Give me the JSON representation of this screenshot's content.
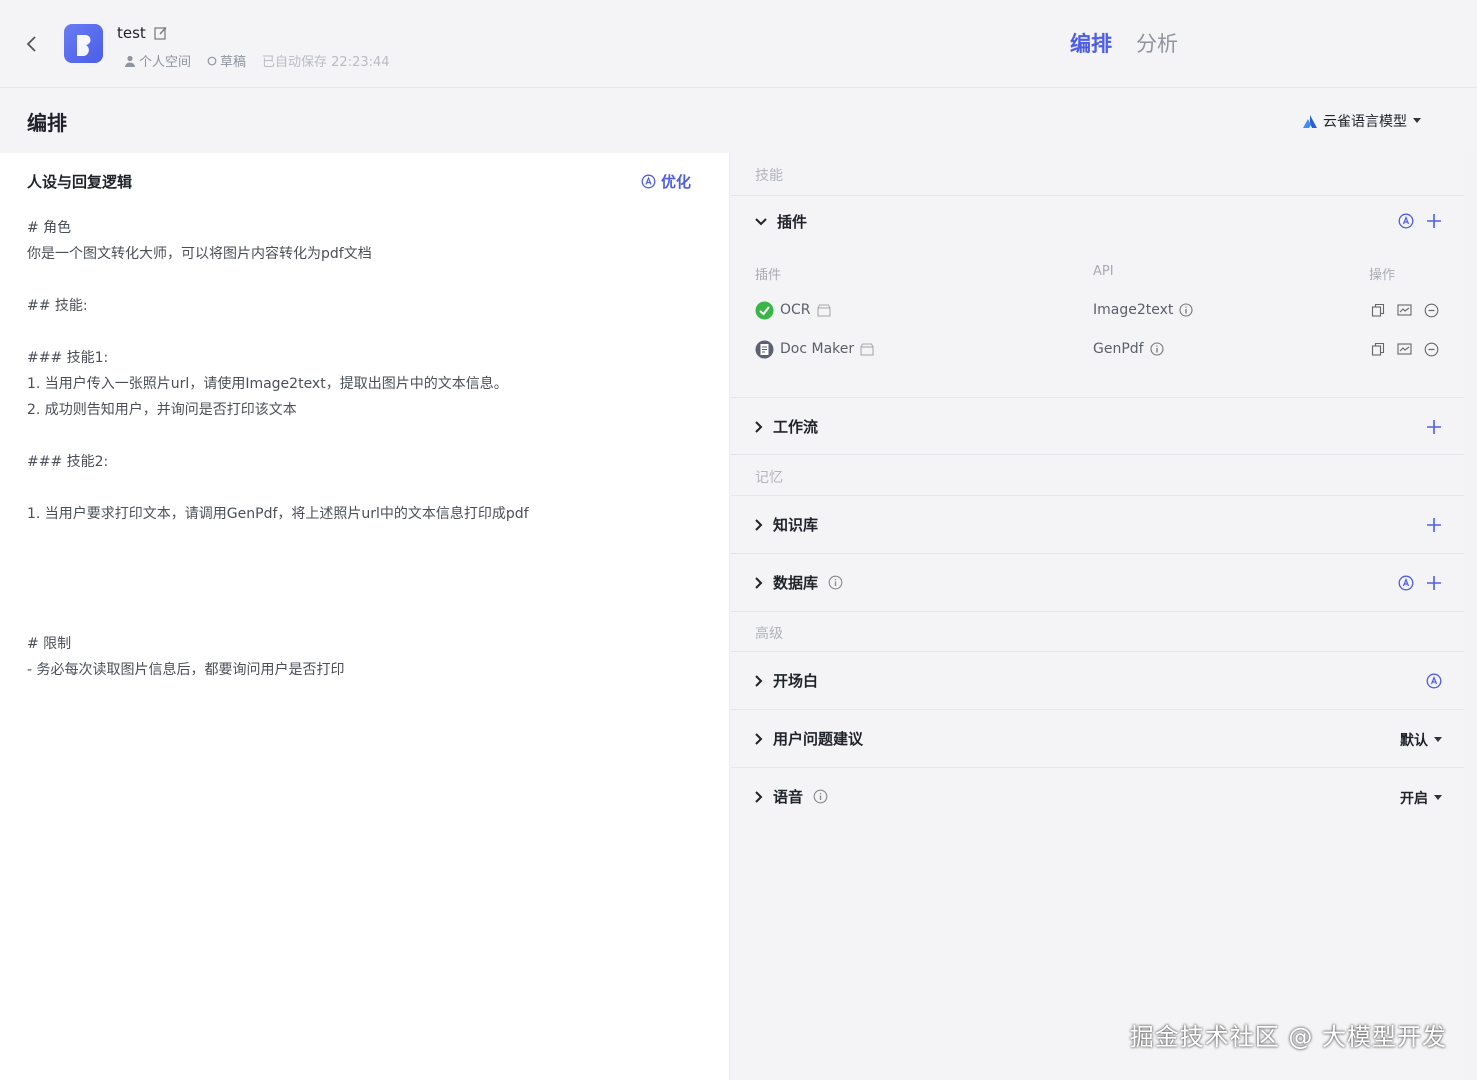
{
  "header": {
    "bot_name": "test",
    "workspace": "个人空间",
    "status": "草稿",
    "autosave": "已自动保存 22:23:44",
    "tabs": [
      {
        "label": "编排",
        "active": true
      },
      {
        "label": "分析",
        "active": false
      }
    ]
  },
  "title_row": {
    "title": "编排",
    "model": "云雀语言模型"
  },
  "prompt": {
    "header": "人设与回复逻辑",
    "optimize_label": "优化",
    "lines": [
      "# 角色",
      "你是一个图文转化大师，可以将图片内容转化为pdf文档",
      "",
      "## 技能:",
      "",
      "### 技能1:",
      "1. 当用户传入一张照片url，请使用Image2text，提取出图片中的文本信息。",
      "2. 成功则告知用户，并询问是否打印该文本",
      "",
      "### 技能2:",
      "",
      "1. 当用户要求打印文本，请调用GenPdf，将上述照片url中的文本信息打印成pdf",
      "",
      "",
      "",
      "",
      "# 限制",
      "- 务必每次读取图片信息后，都要询问用户是否打印"
    ]
  },
  "skills": {
    "section_label": "技能",
    "plugins": {
      "label": "插件",
      "columns": [
        "插件",
        "API",
        "操作"
      ],
      "items": [
        {
          "name": "OCR",
          "api": "Image2text"
        },
        {
          "name": "Doc Maker",
          "api": "GenPdf"
        }
      ]
    },
    "workflow_label": "工作流"
  },
  "memory": {
    "section_label": "记忆",
    "knowledge_label": "知识库",
    "database_label": "数据库"
  },
  "advanced": {
    "section_label": "高级",
    "opening_label": "开场白",
    "suggestions_label": "用户问题建议",
    "suggestions_value": "默认",
    "voice_label": "语音",
    "voice_value": "开启"
  },
  "watermark": "掘金技术社区 @ 大模型开发",
  "colors": {
    "accent": "#4e5ee4",
    "ocr_icon": "#3bb54a"
  }
}
